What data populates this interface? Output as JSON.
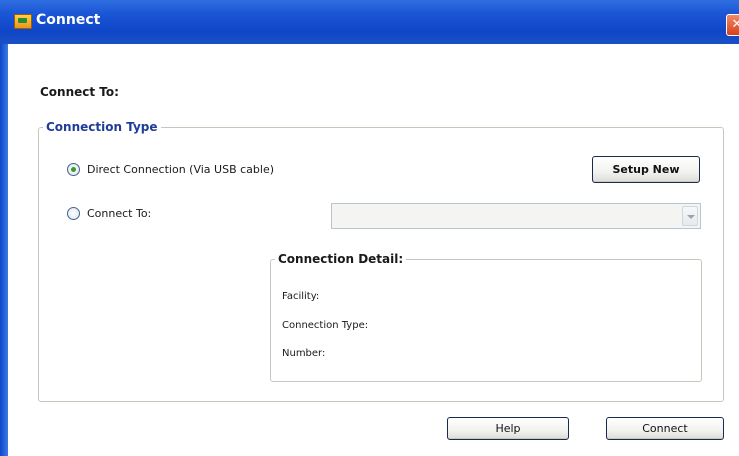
{
  "window": {
    "title": "Connect",
    "close_glyph": "✕"
  },
  "connect_to_heading": "Connect To:",
  "connection_type": {
    "legend": "Connection Type",
    "direct_option": "Direct Connection (Via USB cable)",
    "direct_selected": true,
    "connect_to_option": "Connect To:",
    "connect_to_selected": false,
    "connect_to_value": "",
    "setup_new_label": "Setup New"
  },
  "connection_detail": {
    "legend": "Connection Detail:",
    "facility_label": "Facility:",
    "connection_type_label": "Connection Type:",
    "number_label": "Number:"
  },
  "footer": {
    "help_label": "Help",
    "connect_label": "Connect"
  },
  "icons": {
    "app": "connect-app-icon",
    "close": "close-icon",
    "dropdown": "chevron-down-icon"
  },
  "colors": {
    "titlebar": "#1b56d6",
    "group_legend": "#1f3c9a",
    "radio_selected": "#3a9a2d",
    "close_button": "#d9401c"
  }
}
